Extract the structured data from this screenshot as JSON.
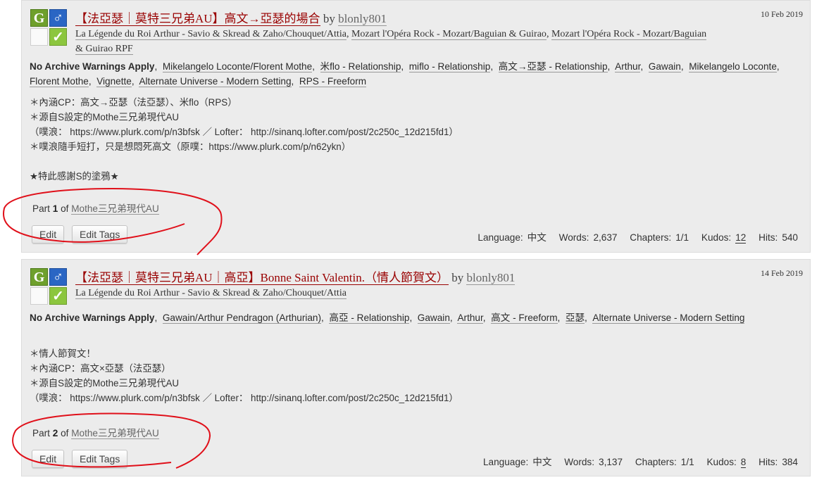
{
  "works": [
    {
      "icons": {
        "rating": "G",
        "category": "♂",
        "complete": "✓"
      },
      "title": "【法亞瑟｜莫特三兄弟AU】高文→亞瑟的場合",
      "by": "by",
      "author": "blonly801",
      "date": "10 Feb 2019",
      "fandoms": [
        "La Légende du Roi Arthur - Savio & Skread & Zaho/Chouquet/Attia",
        "Mozart l'Opéra Rock - Mozart/Baguian & Guirao",
        "Mozart l'Opéra Rock - Mozart/Baguian & Guirao RPF"
      ],
      "warning": "No Archive Warnings Apply",
      "tags": [
        "Mikelangelo Loconte/Florent Mothe",
        "米flo - Relationship",
        "miflo - Relationship",
        "高文→亞瑟 - Relationship",
        "Arthur",
        "Gawain",
        "Mikelangelo Loconte",
        "Florent Mothe",
        "Vignette",
        "Alternate Universe - Modern Setting",
        "RPS - Freeform"
      ],
      "summary": [
        "＊內涵CP：高文→亞瑟（法亞瑟）、米flo（RPS）",
        "＊源自S設定的Mothe三兄弟現代AU",
        "（噗浪： https://www.plurk.com/p/n3bfsk ／ Lofter： http://sinanq.lofter.com/post/2c250c_12d215fd1）",
        "＊噗浪隨手短打，只是想悶死高文（原噗：https://www.plurk.com/p/n62ykn）",
        "",
        "★特此感謝S的塗鴉★"
      ],
      "series": {
        "part_label": "Part",
        "part_num": "1",
        "of_label": "of",
        "name": "Mothe三兄弟現代AU"
      },
      "buttons": {
        "edit": "Edit",
        "edit_tags": "Edit Tags"
      },
      "stats": {
        "language_label": "Language:",
        "language": "中文",
        "words_label": "Words:",
        "words": "2,637",
        "chapters_label": "Chapters:",
        "chapters": "1/1",
        "kudos_label": "Kudos:",
        "kudos": "12",
        "hits_label": "Hits:",
        "hits": "540"
      }
    },
    {
      "icons": {
        "rating": "G",
        "category": "♂",
        "complete": "✓"
      },
      "title": "【法亞瑟｜莫特三兄弟AU｜高亞】Bonne Saint Valentin.（情人節賀文）",
      "by": "by",
      "author": "blonly801",
      "date": "14 Feb 2019",
      "fandoms": [
        "La Légende du Roi Arthur - Savio & Skread & Zaho/Chouquet/Attia"
      ],
      "warning": "No Archive Warnings Apply",
      "tags": [
        "Gawain/Arthur Pendragon (Arthurian)",
        "高亞 - Relationship",
        "Gawain",
        "Arthur",
        "高文 - Freeform",
        "亞瑟",
        "Alternate Universe - Modern Setting"
      ],
      "summary": [
        "＊情人節賀文！",
        "＊內涵CP：高文×亞瑟（法亞瑟）",
        "＊源自S設定的Mothe三兄弟現代AU",
        "（噗浪： https://www.plurk.com/p/n3bfsk ／ Lofter： http://sinanq.lofter.com/post/2c250c_12d215fd1）"
      ],
      "series": {
        "part_label": "Part",
        "part_num": "2",
        "of_label": "of",
        "name": "Mothe三兄弟現代AU"
      },
      "buttons": {
        "edit": "Edit",
        "edit_tags": "Edit Tags"
      },
      "stats": {
        "language_label": "Language:",
        "language": "中文",
        "words_label": "Words:",
        "words": "3,137",
        "chapters_label": "Chapters:",
        "chapters": "1/1",
        "kudos_label": "Kudos:",
        "kudos": "8",
        "hits_label": "Hits:",
        "hits": "384"
      }
    }
  ],
  "colors": {
    "title": "#900000",
    "background": "#ececec",
    "annotation": "#e0101a",
    "rating_icon": "#6fa02c",
    "category_icon": "#2a66c4",
    "complete_icon": "#8cc63e"
  }
}
